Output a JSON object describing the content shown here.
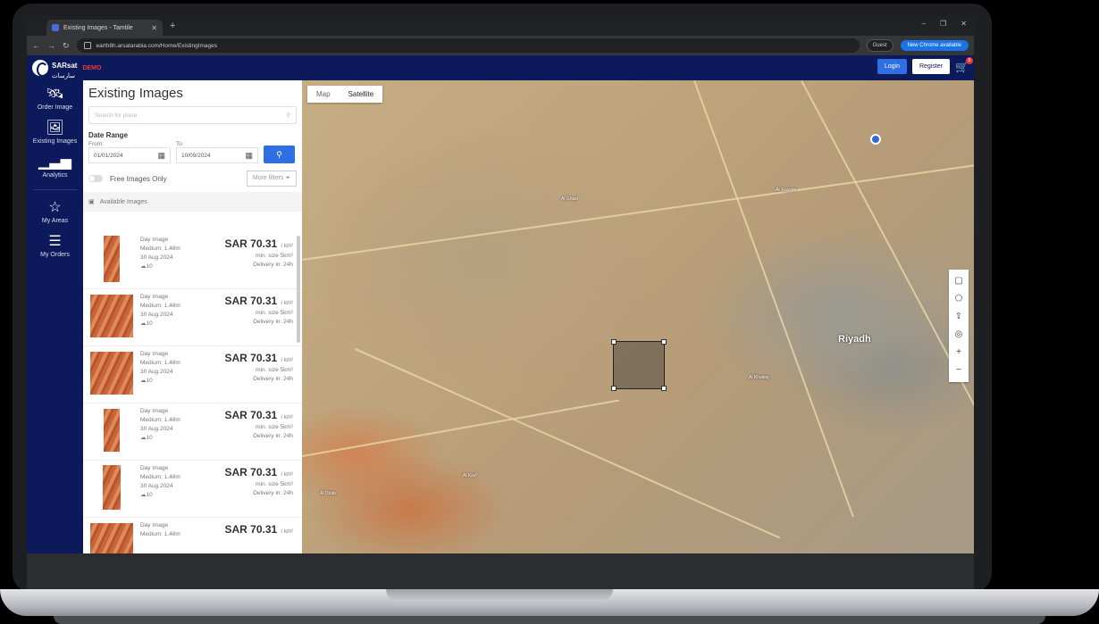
{
  "browser": {
    "tab_title": "Existing Images - Tamtile",
    "url": "earth8h.arsatarabia.com/Home/ExistingImages",
    "guest_label": "Guest",
    "new_version_label": "New Chrome available"
  },
  "header": {
    "logo_text": "SARsat",
    "logo_arabic": "سارسات",
    "demo_label": "DEMO",
    "login_label": "Login",
    "register_label": "Register",
    "cart_count": "0"
  },
  "sidenav": {
    "items": [
      {
        "label": "Order Image",
        "icon": "satellite-icon"
      },
      {
        "label": "Existing Images",
        "icon": "image-icon"
      },
      {
        "label": "Analytics",
        "icon": "analytics-icon"
      },
      {
        "label": "My Areas",
        "icon": "star-icon"
      },
      {
        "label": "My Orders",
        "icon": "menu-icon"
      }
    ]
  },
  "panel": {
    "title": "Existing Images",
    "search_placeholder": "Search for place",
    "date_range_label": "Date Range",
    "from_label": "From:",
    "to_label": "To",
    "from_value": "01/01/2024",
    "to_value": "10/09/2024",
    "free_only_label": "Free Images Only",
    "more_filters_label": "More filters",
    "available_label": "Available Images",
    "cards": [
      {
        "type": "Day image",
        "resolution": "Medium: 1.48m",
        "date": "30 Aug 2024",
        "count": "10",
        "price": "SAR 70.31",
        "unit": "/ km²",
        "min_size": "min. size 5km²",
        "delivery": "Delivery in: 24h"
      },
      {
        "type": "Day image",
        "resolution": "Medium: 1.48m",
        "date": "30 Aug 2024",
        "count": "10",
        "price": "SAR 70.31",
        "unit": "/ km²",
        "min_size": "min. size 5km²",
        "delivery": "Delivery in: 24h"
      },
      {
        "type": "Day image",
        "resolution": "Medium: 1.48m",
        "date": "30 Aug 2024",
        "count": "10",
        "price": "SAR 70.31",
        "unit": "/ km²",
        "min_size": "min. size 5km²",
        "delivery": "Delivery in: 24h"
      },
      {
        "type": "Day image",
        "resolution": "Medium: 1.48m",
        "date": "30 Aug 2024",
        "count": "10",
        "price": "SAR 70.31",
        "unit": "/ km²",
        "min_size": "min. size 5km²",
        "delivery": "Delivery in: 24h"
      },
      {
        "type": "Day image",
        "resolution": "Medium: 1.48m",
        "date": "30 Aug 2024",
        "count": "10",
        "price": "SAR 70.31",
        "unit": "/ km²",
        "min_size": "min. size 5km²",
        "delivery": "Delivery in: 24h"
      },
      {
        "type": "Day image",
        "resolution": "Medium: 1.48m",
        "date": "",
        "count": "",
        "price": "SAR 70.31",
        "unit": "/ km²",
        "min_size": "",
        "delivery": ""
      }
    ]
  },
  "map": {
    "map_tab": "Map",
    "satellite_tab": "Satellite",
    "city_label": "Riyadh",
    "place_labels": [
      "Ar Rayyan",
      "Al Ghazi",
      "Al Khaleej",
      "Al Kayl",
      "Al Dirab"
    ],
    "tools": [
      "rectangle-icon",
      "polygon-icon",
      "upload-icon",
      "locate-icon",
      "zoom-in-icon",
      "zoom-out-icon"
    ]
  }
}
